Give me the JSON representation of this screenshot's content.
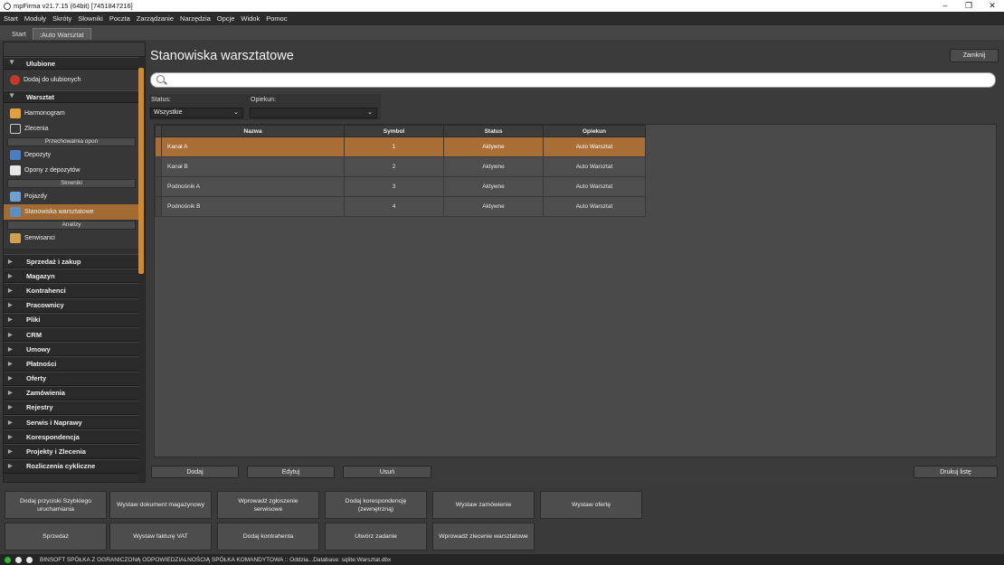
{
  "window": {
    "title": "mpFirma v21.7.15 (64bit) [7451847216]",
    "controls": {
      "minimize": "–",
      "maximize": "❐",
      "close": "✕"
    }
  },
  "menu": [
    "Start",
    "Moduły",
    "Skróty",
    "Słowniki",
    "Poczta",
    "Zarządzanie",
    "Narzędzia",
    "Opcje",
    "Widok",
    "Pomoc"
  ],
  "tabs": [
    {
      "label": "Start",
      "active": false
    },
    {
      "label": ":Auto Warsztat",
      "active": true
    }
  ],
  "sidebar": {
    "favorites": {
      "title": "Ulubione",
      "items": [
        {
          "label": "Dodaj do ulubionych",
          "icon": "add-favorite-icon"
        }
      ]
    },
    "warsztat": {
      "title": "Warsztat",
      "items": [
        {
          "type": "item",
          "label": "Harmonogram",
          "icon": "schedule-icon"
        },
        {
          "type": "item",
          "label": "Zlecenia",
          "icon": "tools-icon"
        },
        {
          "type": "sub",
          "label": "Przechowalnia opon"
        },
        {
          "type": "item",
          "label": "Depozyty",
          "icon": "deposit-icon"
        },
        {
          "type": "item",
          "label": "Opony z depozytów",
          "icon": "document-icon"
        },
        {
          "type": "sub",
          "label": "Słowniki"
        },
        {
          "type": "item",
          "label": "Pojazdy",
          "icon": "car-icon"
        },
        {
          "type": "item",
          "label": "Stanowiska warsztatowe",
          "icon": "workstation-icon",
          "selected": true
        },
        {
          "type": "sub",
          "label": "Analizy"
        },
        {
          "type": "item",
          "label": "Serwisanci",
          "icon": "technician-icon"
        }
      ]
    },
    "sections": [
      "Sprzedaż i zakup",
      "Magazyn",
      "Kontrahenci",
      "Pracownicy",
      "Pliki",
      "CRM",
      "Umowy",
      "Płatności",
      "Oferty",
      "Zamówienia",
      "Rejestry",
      "Serwis i Naprawy",
      "Korespondencja",
      "Projekty i Zlecenia",
      "Rozliczenia cykliczne"
    ]
  },
  "main": {
    "title": "Stanowiska warsztatowe",
    "close_label": "Zamknij",
    "search": {
      "value": "",
      "placeholder": ""
    },
    "filters": {
      "status_label": "Status:",
      "status_value": "Wszystkie",
      "guardian_label": "Opiekun:",
      "guardian_value": ""
    },
    "table": {
      "columns": [
        "Nazwa",
        "Symbol",
        "Status",
        "Opiekun"
      ],
      "rows": [
        {
          "name": "Kanał A",
          "symbol": "1",
          "status": "Aktywne",
          "guardian": "Auto Warsztat",
          "selected": true
        },
        {
          "name": "Kanał B",
          "symbol": "2",
          "status": "Aktywne",
          "guardian": "Auto Warsztat"
        },
        {
          "name": "Podnośnik A",
          "symbol": "3",
          "status": "Aktywne",
          "guardian": "Auto Warsztat"
        },
        {
          "name": "Podnośnik B",
          "symbol": "4",
          "status": "Aktywne",
          "guardian": "Auto Warsztat"
        }
      ]
    },
    "actions": {
      "add": "Dodaj",
      "edit": "Edytuj",
      "delete": "Usuń",
      "print": "Drukuj listę"
    }
  },
  "quick_actions": [
    "Dodaj przyciski Szybkiego uruchamiania",
    "Wystaw dokument magazynowy",
    "Wprowadź zgłoszenie serwisowe",
    "Dodaj korespondencję (zewnętrzną)",
    "Wystaw zamówienie",
    "Wystaw ofertę",
    "Sprzedaż",
    "Wystaw fakturę VAT",
    "Dodaj kontrahenta",
    "Utwórz zadanie",
    "Wprowadź zlecenie warsztatowe"
  ],
  "status_bar": {
    "text": "BINSOFT SPÓŁKA Z OGRANICZONĄ ODPOWIEDZIALNOŚCIĄ SPÓŁKA KOMANDYTOWA :: Oddzia...Database: sqlite:Warsztat.dbx",
    "indicators": [
      "#2db82d",
      "#e8e8e8",
      "#e8e8e8"
    ]
  },
  "colors": {
    "accent": "#a96d36",
    "scroll": "#d08a2c"
  }
}
